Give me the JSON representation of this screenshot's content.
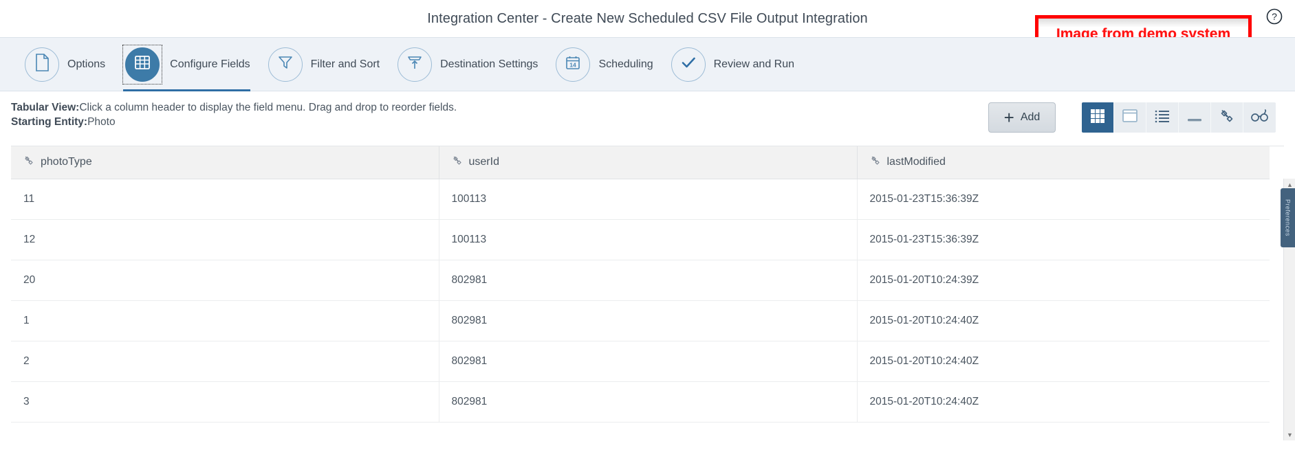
{
  "header": {
    "title": "Integration Center - Create New Scheduled CSV File Output Integration",
    "help_icon": "help-circle-icon",
    "annotation": "Image from demo system",
    "annotation_color": "#ff0000"
  },
  "steps": [
    {
      "label": "Options",
      "icon": "document-icon",
      "active": false
    },
    {
      "label": "Configure Fields",
      "icon": "grid-table-icon",
      "active": true
    },
    {
      "label": "Filter and Sort",
      "icon": "funnel-icon",
      "active": false
    },
    {
      "label": "Destination Settings",
      "icon": "upload-box-icon",
      "active": false
    },
    {
      "label": "Scheduling",
      "icon": "calendar-icon",
      "active": false,
      "calendar_day": "14"
    },
    {
      "label": "Review and Run",
      "icon": "check-icon",
      "active": false
    }
  ],
  "subheader": {
    "tabular_view_label": "Tabular View:",
    "tabular_view_text": "Click a column header to display the field menu. Drag and drop to reorder fields.",
    "starting_entity_label": "Starting Entity:",
    "starting_entity_value": "Photo"
  },
  "toolbar": {
    "add_label": "Add",
    "add_icon": "plus-icon",
    "views": [
      {
        "name": "grid-view",
        "icon": "grid-icon",
        "active": true
      },
      {
        "name": "card-view",
        "icon": "window-icon",
        "active": false
      },
      {
        "name": "list-view",
        "icon": "list-icon",
        "active": false
      },
      {
        "name": "collapse-view",
        "icon": "dash-icon",
        "active": false
      },
      {
        "name": "connector",
        "icon": "plug-connector-icon",
        "active": false
      },
      {
        "name": "preview",
        "icon": "glasses-icon",
        "active": false
      }
    ]
  },
  "table": {
    "columns": [
      {
        "label": "photoType",
        "icon": "field-link-icon"
      },
      {
        "label": "userId",
        "icon": "field-link-icon"
      },
      {
        "label": "lastModified",
        "icon": "field-link-icon"
      }
    ],
    "rows": [
      {
        "photoType": "11",
        "userId": "100113",
        "lastModified": "2015-01-23T15:36:39Z"
      },
      {
        "photoType": "12",
        "userId": "100113",
        "lastModified": "2015-01-23T15:36:39Z"
      },
      {
        "photoType": "20",
        "userId": "802981",
        "lastModified": "2015-01-20T10:24:39Z"
      },
      {
        "photoType": "1",
        "userId": "802981",
        "lastModified": "2015-01-20T10:24:40Z"
      },
      {
        "photoType": "2",
        "userId": "802981",
        "lastModified": "2015-01-20T10:24:40Z"
      },
      {
        "photoType": "3",
        "userId": "802981",
        "lastModified": "2015-01-20T10:24:40Z"
      }
    ]
  },
  "scrollbar": {
    "up_icon": "chevron-up-icon",
    "down_icon": "chevron-down-icon",
    "side_tab_text": "Preferences"
  },
  "colors": {
    "accent": "#2f6ea5",
    "step_active": "#3d7ba8",
    "stepbar_bg": "#eef2f7",
    "header_row_bg": "#f2f2f2",
    "text": "#4a5560"
  }
}
